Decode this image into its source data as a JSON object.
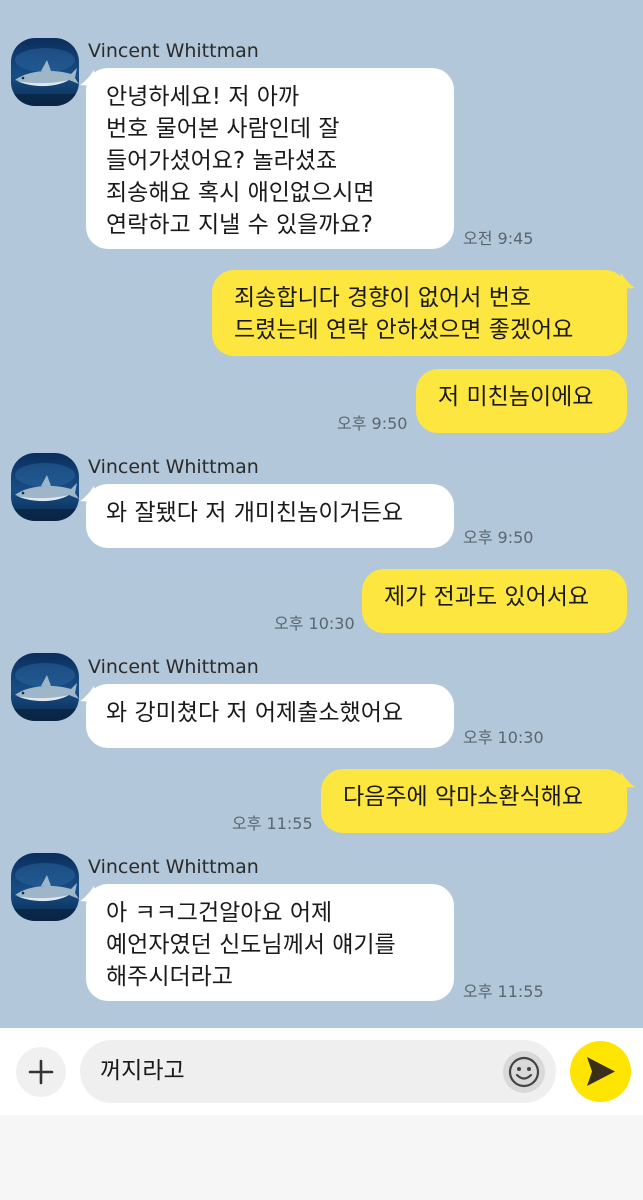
{
  "contact": {
    "name": "Vincent Whittman"
  },
  "messages": [
    {
      "text": "안녕하세요! 저 아까\n번호 물어본 사람인데 잘\n들어가셨어요? 놀라셨죠\n죄송해요 혹시 애인없으시면\n연락하고 지낼 수 있을까요?",
      "time": "오전 9:45"
    },
    {
      "text": "죄송합니다 경향이 없어서 번호\n드렸는데 연락 안하셨으면 좋겠어요"
    },
    {
      "text": "저 미친놈이에요",
      "time": "오후 9:50"
    },
    {
      "text": "와 잘됐다 저 개미친놈이거든요",
      "time": "오후 9:50"
    },
    {
      "text": "제가 전과도 있어서요",
      "time": "오후 10:30"
    },
    {
      "text": "와 강미쳤다 저 어제출소했어요",
      "time": "오후 10:30"
    },
    {
      "text": "다음주에 악마소환식해요",
      "time": "오후 11:55"
    },
    {
      "text": "아 ㅋㅋ그건알아요 어제\n예언자였던 신도님께서 얘기를\n해주시더라고",
      "time": "오후 11:55"
    }
  ],
  "composer": {
    "input_value": "꺼지라고"
  },
  "icons": {
    "plus": "plus-icon",
    "emoji": "smiley-icon",
    "send": "send-arrow-icon",
    "avatar": "shark-photo"
  },
  "colors": {
    "chat_background": "#b2c7da",
    "incoming_bubble": "#ffffff",
    "outgoing_bubble": "#fee640",
    "send_button": "#fee500"
  }
}
